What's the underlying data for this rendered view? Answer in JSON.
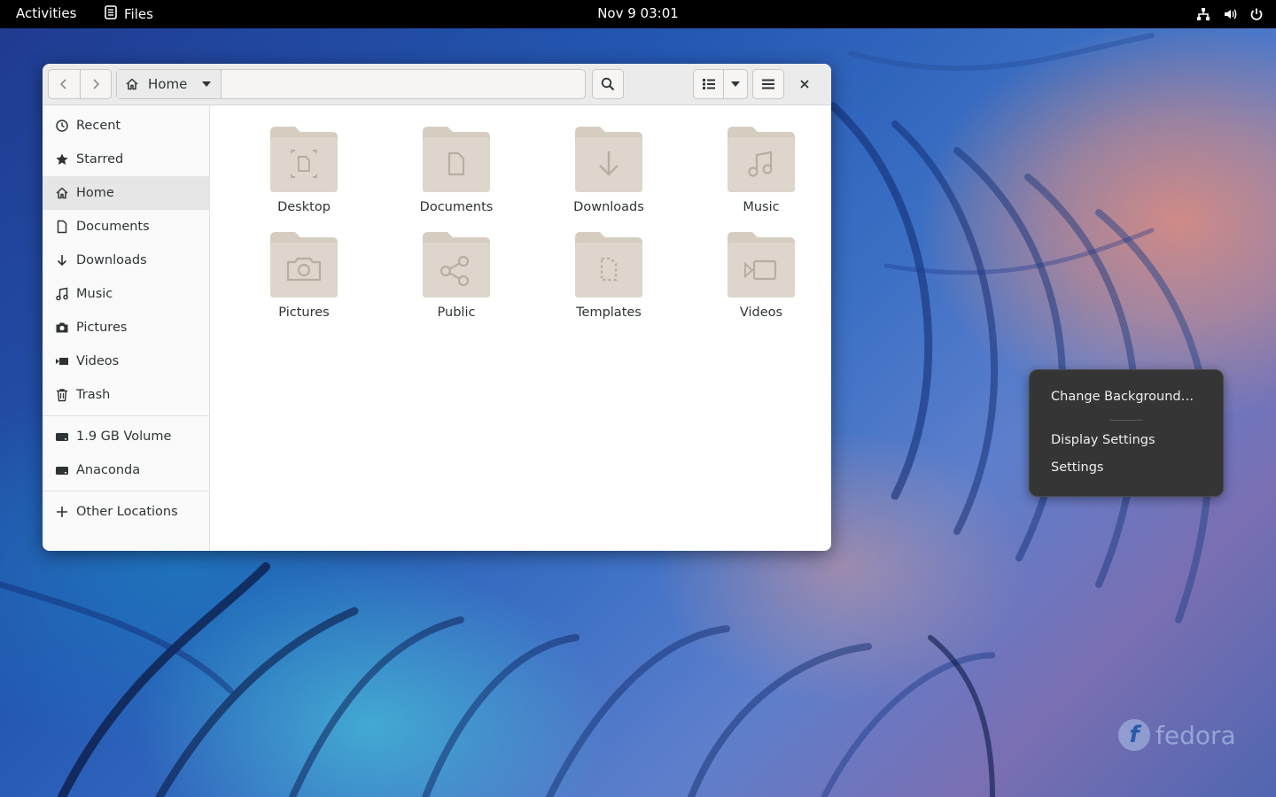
{
  "topbar": {
    "activities": "Activities",
    "app_name": "Files",
    "clock": "Nov 9  03:01"
  },
  "window": {
    "pathbar": {
      "current": "Home"
    },
    "sidebar": {
      "places": [
        {
          "label": "Recent",
          "icon": "clock-icon"
        },
        {
          "label": "Starred",
          "icon": "star-icon"
        },
        {
          "label": "Home",
          "icon": "home-icon",
          "active": true
        },
        {
          "label": "Documents",
          "icon": "document-icon"
        },
        {
          "label": "Downloads",
          "icon": "download-icon"
        },
        {
          "label": "Music",
          "icon": "music-icon"
        },
        {
          "label": "Pictures",
          "icon": "camera-icon"
        },
        {
          "label": "Videos",
          "icon": "video-icon"
        },
        {
          "label": "Trash",
          "icon": "trash-icon"
        }
      ],
      "devices": [
        {
          "label": "1.9 GB Volume",
          "icon": "drive-icon"
        },
        {
          "label": "Anaconda",
          "icon": "drive-icon"
        }
      ],
      "other": {
        "label": "Other Locations",
        "icon": "plus-icon"
      }
    },
    "folders": [
      {
        "label": "Desktop",
        "icon": "desktop-folder-icon"
      },
      {
        "label": "Documents",
        "icon": "documents-folder-icon"
      },
      {
        "label": "Downloads",
        "icon": "downloads-folder-icon"
      },
      {
        "label": "Music",
        "icon": "music-folder-icon"
      },
      {
        "label": "Pictures",
        "icon": "pictures-folder-icon"
      },
      {
        "label": "Public",
        "icon": "public-folder-icon"
      },
      {
        "label": "Templates",
        "icon": "templates-folder-icon"
      },
      {
        "label": "Videos",
        "icon": "videos-folder-icon"
      }
    ]
  },
  "context_menu": {
    "items": [
      "Change Background…",
      "Display Settings",
      "Settings"
    ]
  },
  "branding": {
    "wordmark": "fedora"
  },
  "colors": {
    "folder": "#ded6cc",
    "folder_glyph": "#b9ada1",
    "menu_bg": "#353535"
  }
}
